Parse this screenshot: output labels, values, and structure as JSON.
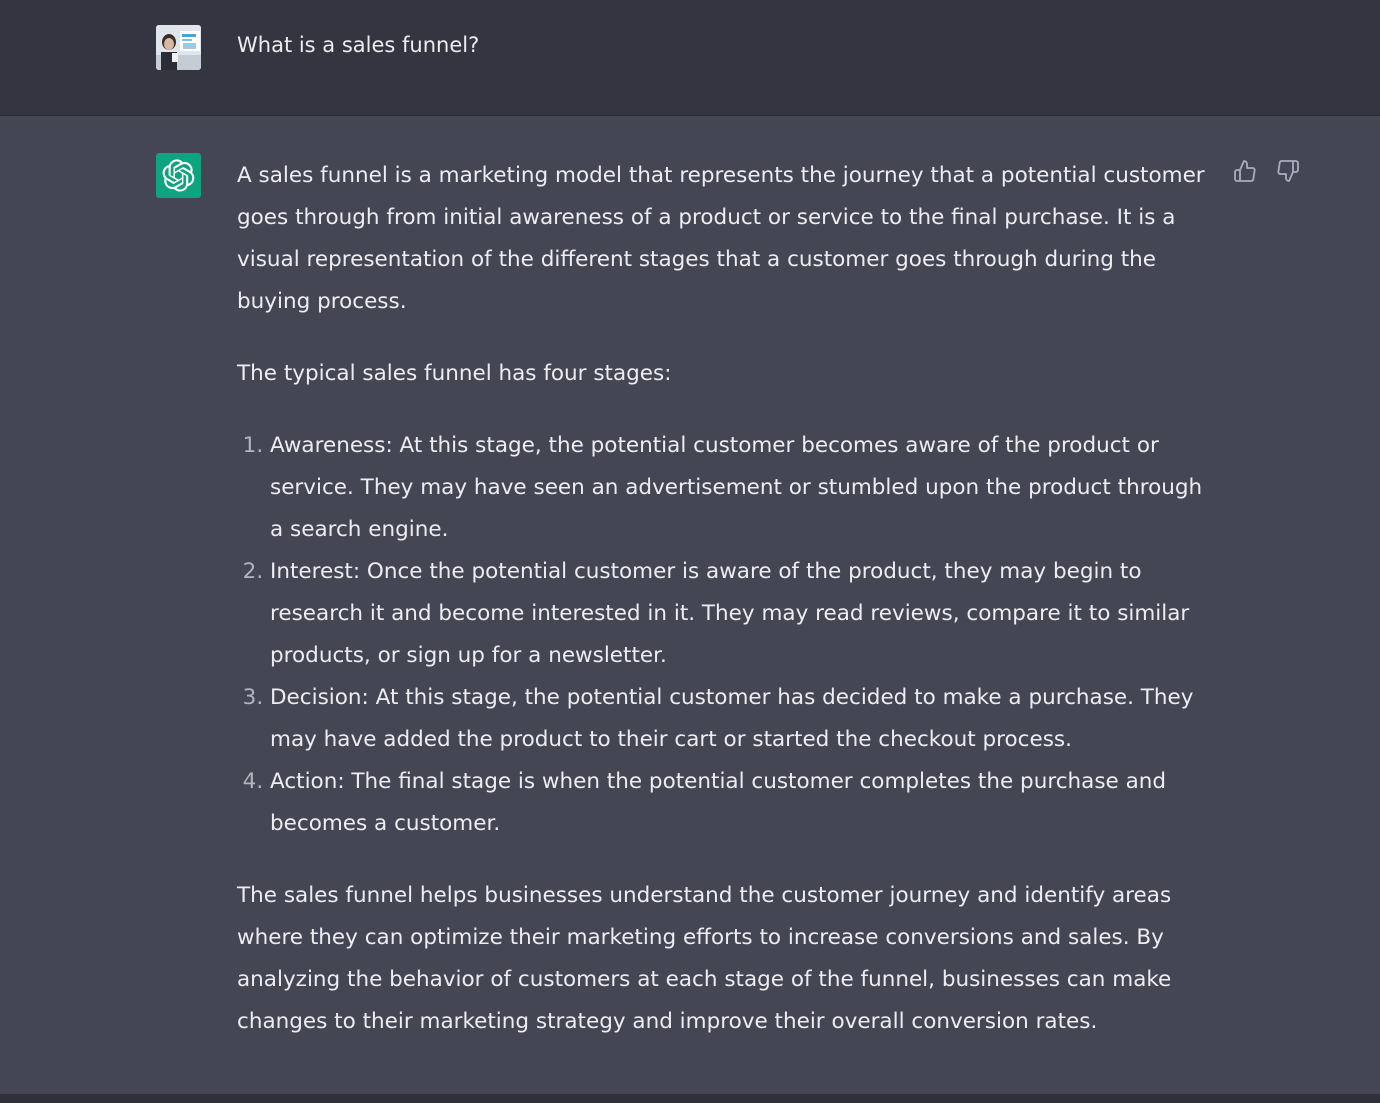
{
  "conversation": {
    "user_message": "What is a sales funnel?",
    "assistant": {
      "intro": "A sales funnel is a marketing model that represents the journey that a potential customer goes through from initial awareness of a product or service to the final purchase. It is a visual representation of the different stages that a customer goes through during the buying process.",
      "stages_heading": "The typical sales funnel has four stages:",
      "stages": [
        "Awareness: At this stage, the potential customer becomes aware of the product or service. They may have seen an advertisement or stumbled upon the product through a search engine.",
        "Interest: Once the potential customer is aware of the product, they may begin to research it and become interested in it. They may read reviews, compare it to similar products, or sign up for a newsletter.",
        "Decision: At this stage, the potential customer has decided to make a purchase. They may have added the product to their cart or started the checkout process.",
        "Action: The final stage is when the potential customer completes the purchase and becomes a customer."
      ],
      "conclusion": "The sales funnel helps businesses understand the customer journey and identify areas where they can optimize their marketing efforts to increase conversions and sales. By analyzing the behavior of customers at each stage of the funnel, businesses can make changes to their marketing strategy and improve their overall conversion rates."
    }
  },
  "icons": {
    "user_avatar": "user-avatar",
    "assistant_logo": "openai-logo-icon",
    "like": "thumbs-up-icon",
    "dislike": "thumbs-down-icon"
  },
  "colors": {
    "user_row_bg": "#343541",
    "assistant_row_bg": "#444654",
    "logo_bg": "#10a37f",
    "text": "#ececf1",
    "icon": "#acacbe"
  }
}
